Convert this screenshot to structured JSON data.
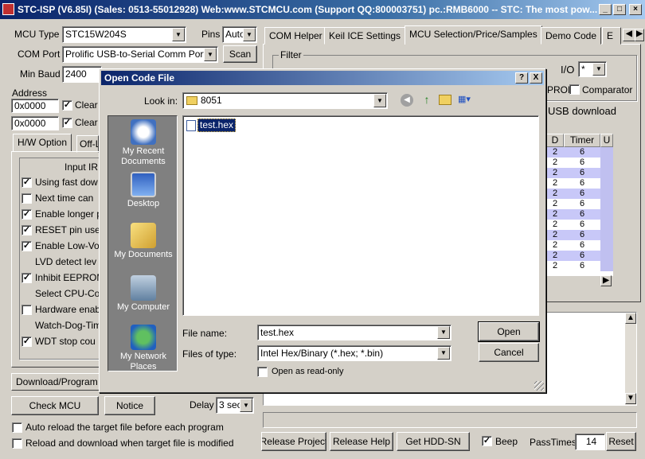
{
  "window": {
    "title": "STC-ISP (V6.85I) (Sales: 0513-55012928) Web:www.STCMCU.com  (Support QQ:800003751)  pc.:RMB6000 -- STC: The most pow..."
  },
  "left": {
    "mcu_type_label": "MCU Type",
    "mcu_type_value": "STC15W204S",
    "pins_label": "Pins",
    "pins_value": "Auto",
    "com_port_label": "COM Port",
    "com_port_value": "Prolific USB-to-Serial Comm Port",
    "scan_label": "Scan",
    "min_baud_label": "Min Baud",
    "min_baud_value": "2400",
    "address_label": "Address",
    "addr1": "0x0000",
    "addr2": "0x0000",
    "clear1": "Clear",
    "clear2": "Clear",
    "tabs": [
      "H/W Option",
      "Off-L"
    ],
    "input_ir": "Input IR",
    "options": [
      {
        "label": "Using fast dow",
        "checked": true
      },
      {
        "label": "Next time can",
        "checked": false
      },
      {
        "label": "Enable longer p",
        "checked": true
      },
      {
        "label": "RESET pin use",
        "checked": true
      },
      {
        "label": "Enable Low-Vo",
        "checked": true
      },
      {
        "label": "LVD detect lev",
        "checked": null
      },
      {
        "label": "Inhibit EEPROM",
        "checked": true
      },
      {
        "label": "Select CPU-Cor",
        "checked": null
      },
      {
        "label": "Hardware enab",
        "checked": false
      },
      {
        "label": "Watch-Dog-Tim",
        "checked": null
      },
      {
        "label": "WDT stop cou",
        "checked": true
      }
    ],
    "download_program": "Download/Program",
    "check_mcu": "Check MCU",
    "notice": "Notice",
    "delay_label": "Delay",
    "delay_value": "3 sec",
    "auto_reload": "Auto reload the target file before each program",
    "reload_download": "Reload and download when target file is modified"
  },
  "right": {
    "tabs": [
      "COM Helper",
      "Keil ICE Settings",
      "MCU Selection/Price/Samples",
      "Demo Code",
      "E"
    ],
    "filter_label": "Filter",
    "io_label": "I/O",
    "io_value": "*",
    "eeprom_label": "PROM",
    "comparator_label": "Comparator",
    "usb_download": "USB download",
    "col_d": "D",
    "col_timer": "Timer",
    "col_u": "U",
    "rows": [
      [
        "2",
        "6"
      ],
      [
        "2",
        "6"
      ],
      [
        "2",
        "6"
      ],
      [
        "2",
        "6"
      ],
      [
        "2",
        "6"
      ],
      [
        "2",
        "6"
      ],
      [
        "2",
        "6"
      ],
      [
        "2",
        "6"
      ],
      [
        "2",
        "6"
      ],
      [
        "2",
        "6"
      ],
      [
        "2",
        "6"
      ],
      [
        "2",
        "6"
      ]
    ],
    "release_project": "Release Project",
    "release_help": "Release Help",
    "get_hdd_sn": "Get HDD-SN",
    "beep": "Beep",
    "pass_times_label": "PassTimes",
    "pass_times_value": "14",
    "reset": "Reset"
  },
  "dialog": {
    "title": "Open Code File",
    "help_btn": "?",
    "close_btn": "X",
    "look_in_label": "Look in:",
    "look_in_value": "8051",
    "places": [
      "My Recent Documents",
      "Desktop",
      "My Documents",
      "My Computer",
      "My Network Places"
    ],
    "file": "test.hex",
    "file_name_label": "File name:",
    "file_name_value": "test.hex",
    "files_of_type_label": "Files of type:",
    "files_of_type_value": "Intel Hex/Binary (*.hex; *.bin)",
    "read_only": "Open as read-only",
    "open": "Open",
    "cancel": "Cancel"
  },
  "colors": {
    "title_blue": "#0a246a",
    "grid_blue": "#c8c8f8",
    "selection": "#0a246a"
  }
}
